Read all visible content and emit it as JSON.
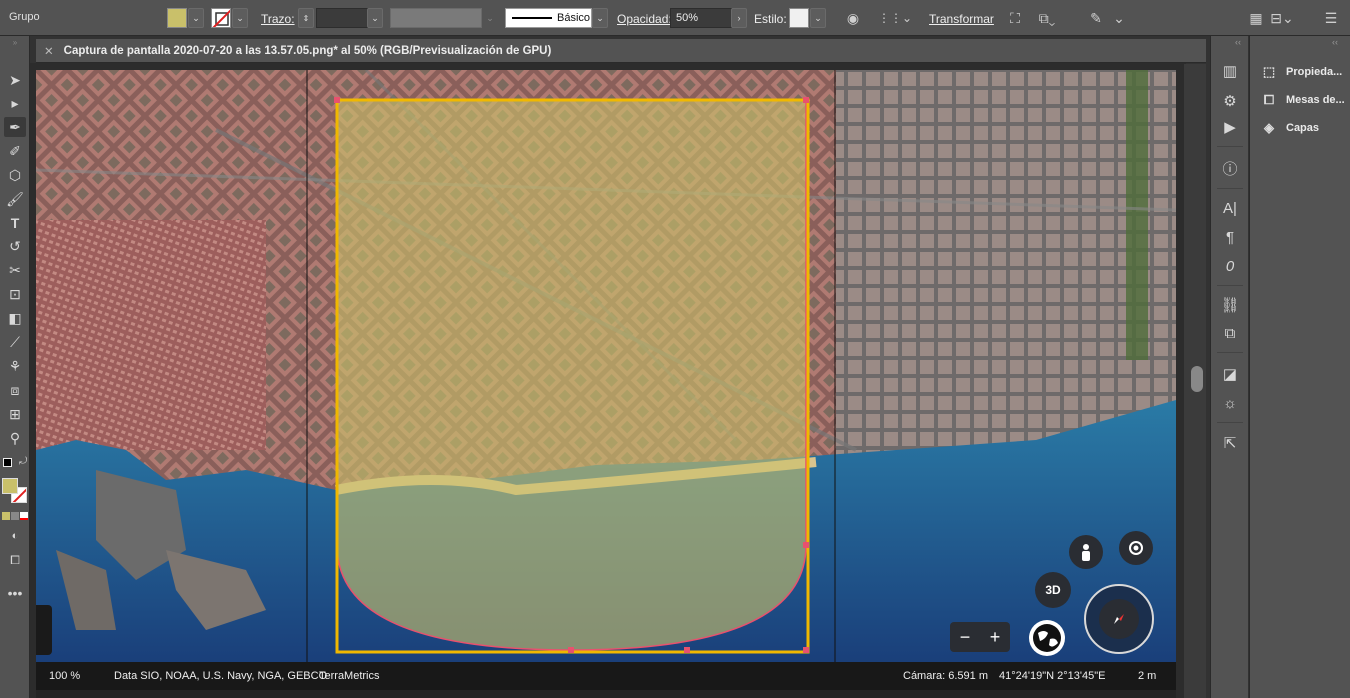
{
  "control_bar": {
    "selection_label": "Grupo",
    "fill_color": "#c9c06a",
    "stroke_label": "Trazo:",
    "stroke_value": "",
    "brush_label": "Básico",
    "opacity_label": "Opacidad:",
    "opacity_value": "50%",
    "style_label": "Estilo:",
    "transform_label": "Transformar"
  },
  "document": {
    "tab_title": "Captura de pantalla 2020-07-20 a las 13.57.05.png* al 50% (RGB/Previsualización de GPU)"
  },
  "right_panel": {
    "items": [
      {
        "label": "Propieda...",
        "icon": "properties-icon"
      },
      {
        "label": "Mesas de...",
        "icon": "artboards-icon"
      },
      {
        "label": "Capas",
        "icon": "layers-icon"
      }
    ]
  },
  "map": {
    "zoom_percent": "100 %",
    "attribution": "Data SIO, NOAA, U.S. Navy, NGA, GEBCO",
    "attribution2": "TerraMetrics",
    "camera": "Cámara: 6.591 m",
    "coords": "41°24'19\"N 2°13'45\"E",
    "scale": "2 m",
    "btn_3d": "3D",
    "zoom_minus": "−",
    "zoom_plus": "+"
  },
  "colors": {
    "shape_fill": "#c9c06a",
    "shape_stroke": "#f0b800",
    "path_stroke": "#e8516e",
    "sea": "#1f4d8a",
    "city": "#9a6f6a"
  }
}
